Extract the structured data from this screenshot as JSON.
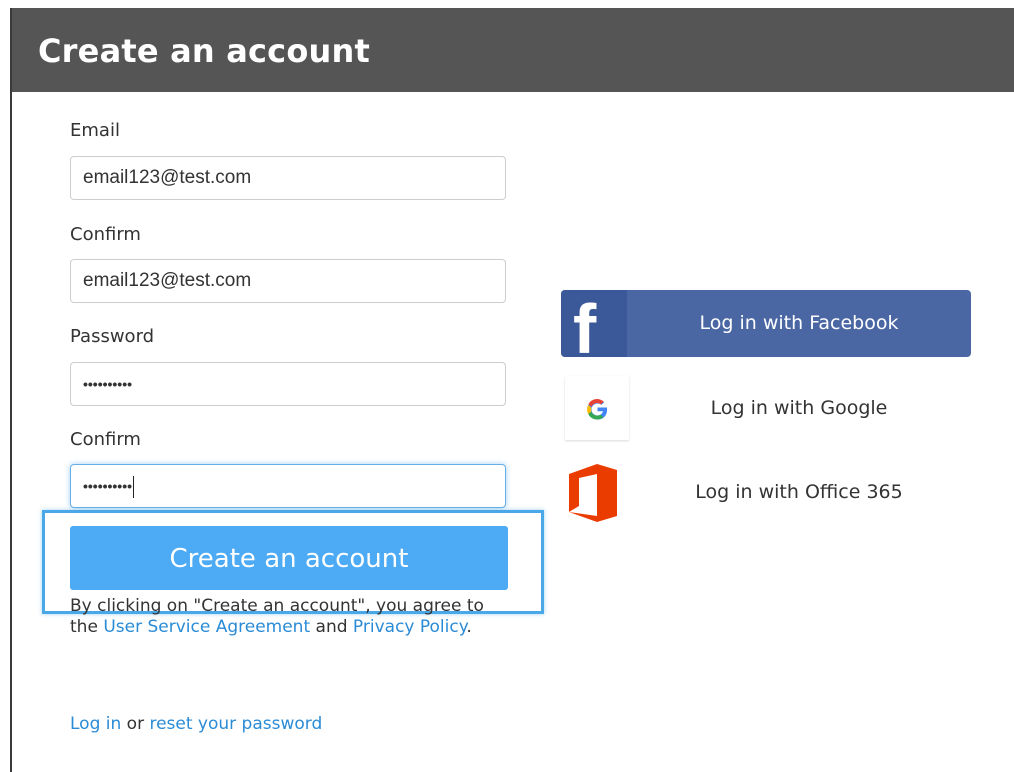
{
  "header": {
    "title": "Create an account"
  },
  "form": {
    "email_label": "Email",
    "email_value": "email123@test.com",
    "confirm_email_label": "Confirm",
    "confirm_email_value": "email123@test.com",
    "password_label": "Password",
    "password_mask": "••••••••••",
    "confirm_password_label": "Confirm",
    "confirm_password_mask": "••••••••••",
    "submit_label": "Create an account"
  },
  "terms": {
    "prefix": "By clicking on \"Create an account\", you agree to the ",
    "agreement_link": "User Service Agreement",
    "middle": " and ",
    "privacy_link": "Privacy Policy",
    "suffix": "."
  },
  "footer": {
    "login_link": "Log in",
    "or_text": " or ",
    "reset_link": "reset your password"
  },
  "social": {
    "facebook_label": "Log in with Facebook",
    "google_label": "Log in with Google",
    "google_icon_text": "G",
    "office_label": "Log in with Office 365",
    "facebook_icon_text": "f"
  },
  "colors": {
    "header_bg": "#555555",
    "accent": "#4daaf5",
    "link": "#2a8bd6",
    "facebook": "#4a67a4",
    "office": "#eb3c00",
    "highlight_border": "#4aa8e8"
  }
}
